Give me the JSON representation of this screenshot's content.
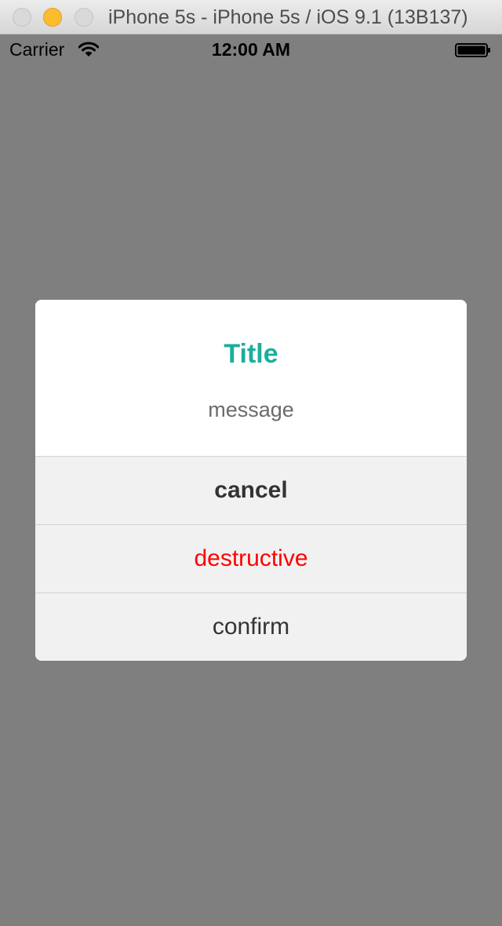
{
  "window": {
    "title": "iPhone 5s - iPhone 5s / iOS 9.1 (13B137)"
  },
  "statusbar": {
    "carrier": "Carrier",
    "time": "12:00 AM",
    "icons": [
      "wifi-icon",
      "battery-icon"
    ]
  },
  "alert": {
    "title": "Title",
    "message": "message",
    "buttons": [
      {
        "label": "cancel",
        "style": "bold",
        "color": "#333333"
      },
      {
        "label": "destructive",
        "style": "destructive",
        "color": "#ff0000"
      },
      {
        "label": "confirm",
        "style": "default",
        "color": "#333333"
      }
    ],
    "title_color": "#1aaf9a"
  }
}
